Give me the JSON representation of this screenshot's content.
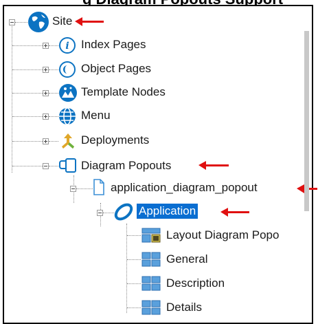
{
  "header_fragment": "g Diagram Popouts Support",
  "tree": {
    "site": "Site",
    "index_pages": "Index Pages",
    "object_pages": "Object Pages",
    "template_nodes": "Template Nodes",
    "menu": "Menu",
    "deployments": "Deployments",
    "diagram_popouts": "Diagram Popouts",
    "popout_file": "application_diagram_popout",
    "application": "Application",
    "layout": "Layout Diagram Popo",
    "general": "General",
    "description": "Description",
    "details": "Details"
  },
  "icons": {
    "site": "globe-icon",
    "index_pages": "info-circle-icon",
    "object_pages": "object-circle-icon",
    "template_nodes": "template-icon",
    "menu": "menu-globe-icon",
    "deployments": "deploy-arrows-icon",
    "diagram_popouts": "diagram-icon",
    "popout_file": "document-icon",
    "application": "ellipse-icon",
    "layout": "layout-grid-icon",
    "section": "table-icon"
  },
  "colors": {
    "selection": "#0a6ed1",
    "annotation_arrow": "#e01010"
  }
}
